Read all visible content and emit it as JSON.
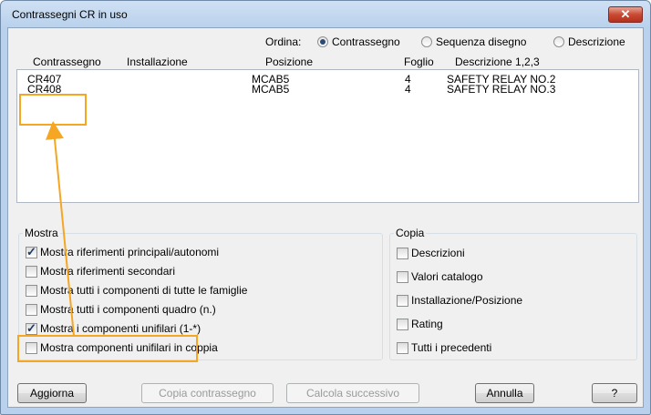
{
  "window": {
    "title": "Contrassegni CR in uso",
    "close_label": "✕"
  },
  "sort": {
    "label": "Ordina:",
    "options": [
      {
        "label": "Contrassegno",
        "selected": true
      },
      {
        "label": "Sequenza disegno",
        "selected": false
      },
      {
        "label": "Descrizione",
        "selected": false
      }
    ]
  },
  "list": {
    "columns": [
      "Contrassegno",
      "Installazione",
      "Posizione",
      "Foglio",
      "Descrizione 1,2,3"
    ],
    "rows": [
      [
        "CR407",
        "",
        "MCAB5",
        "4",
        "SAFETY RELAY NO.2"
      ],
      [
        "CR408",
        "",
        "MCAB5",
        "4",
        "SAFETY RELAY NO.3"
      ]
    ]
  },
  "mostra": {
    "title": "Mostra",
    "options": [
      {
        "label": "Mostra riferimenti principali/autonomi",
        "checked": true
      },
      {
        "label": "Mostra riferimenti secondari",
        "checked": false
      },
      {
        "label": "Mostra tutti i componenti di tutte le famiglie",
        "checked": false
      },
      {
        "label": "Mostra tutti i componenti quadro (n.)",
        "checked": false
      },
      {
        "label": "Mostra i componenti unifilari (1-*)",
        "checked": true
      },
      {
        "label": "Mostra componenti unifilari in coppia",
        "checked": false
      }
    ]
  },
  "copia": {
    "title": "Copia",
    "options": [
      {
        "label": "Descrizioni",
        "checked": false
      },
      {
        "label": "Valori catalogo",
        "checked": false
      },
      {
        "label": "Installazione/Posizione",
        "checked": false
      },
      {
        "label": "Rating",
        "checked": false
      },
      {
        "label": "Tutti i precedenti",
        "checked": false
      }
    ]
  },
  "buttons": {
    "refresh": "Aggiorna",
    "copy_tag": "Copia contrassegno",
    "calc_next": "Calcola successivo",
    "cancel": "Annulla",
    "help": "?"
  },
  "annotation_color": "#f5a623"
}
